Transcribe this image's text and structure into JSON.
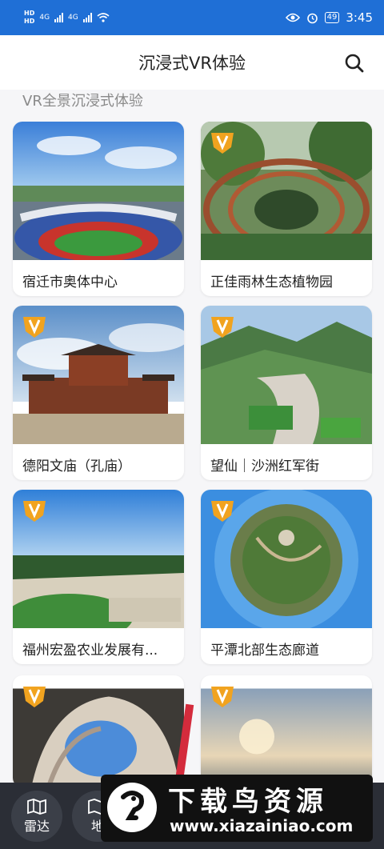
{
  "status_bar": {
    "hd1": "HD",
    "hd2": "HD",
    "net1": "4G",
    "net2": "4G",
    "battery": "49",
    "time": "3:45"
  },
  "header": {
    "title": "沉浸式VR体验",
    "search_icon": "search-icon"
  },
  "section": {
    "title": "VR全景沉浸式体验"
  },
  "cards": [
    {
      "label": "宿迁市奥体中心",
      "vip": false
    },
    {
      "label": "正佳雨林生态植物园",
      "vip": true
    },
    {
      "label": "德阳文庙（孔庙）",
      "vip": true
    },
    {
      "label": "望仙｜沙洲红军街",
      "vip": true
    },
    {
      "label": "福州宏盈农业发展有...",
      "vip": true
    },
    {
      "label": "平潭北部生态廊道",
      "vip": true
    },
    {
      "label": "",
      "vip": true
    },
    {
      "label": "",
      "vip": true
    }
  ],
  "bottom_nav": [
    {
      "label": "雷达",
      "icon": "map-icon"
    },
    {
      "label": "地",
      "icon": "map-icon"
    }
  ],
  "watermark": {
    "title": "下载鸟资源",
    "url": "www.xiazainiao.com"
  },
  "colors": {
    "status_bar": "#1f6fd6",
    "badge": "#f1a31f",
    "bottom_bar": "#2b2e36"
  }
}
